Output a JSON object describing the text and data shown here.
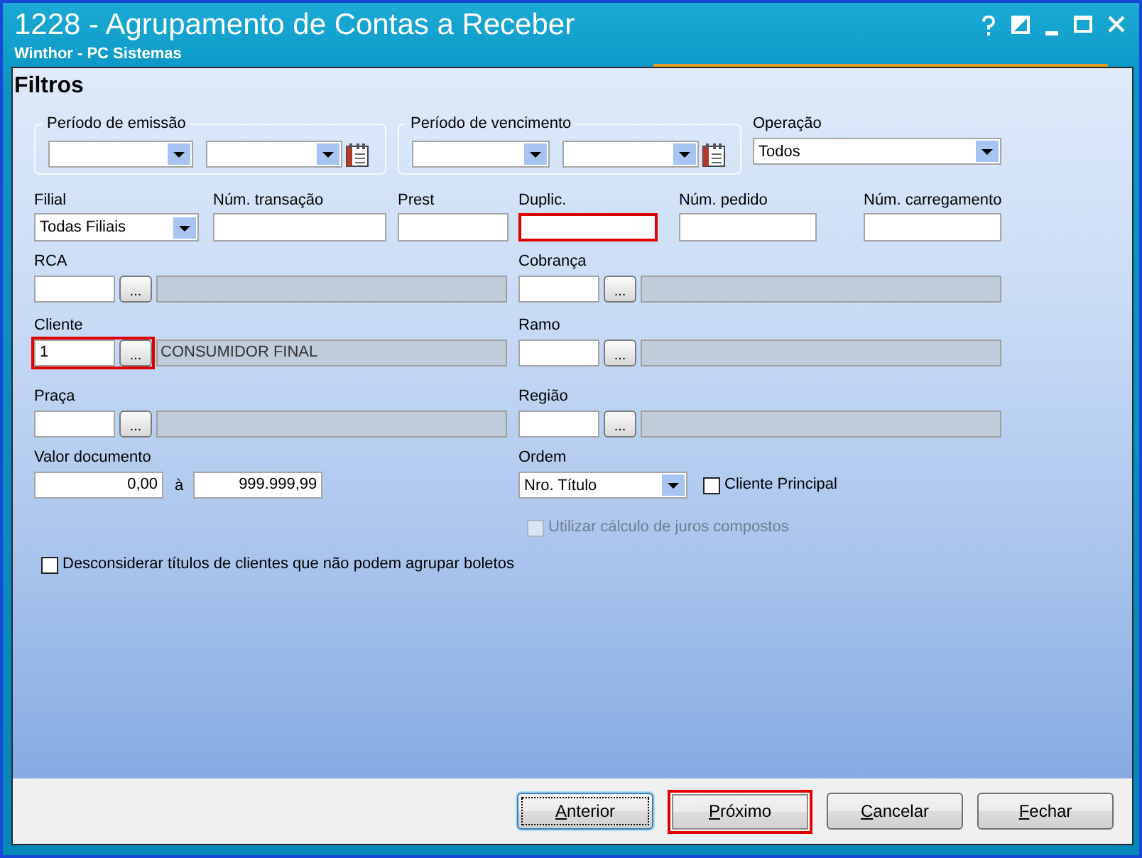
{
  "window": {
    "title": "1228 - Agrupamento de Contas a Receber",
    "subtitle": "Winthor - PC Sistemas"
  },
  "heading": "Filtros",
  "periods": [
    {
      "label": "Período de emissão"
    },
    {
      "label": "Período de vencimento"
    }
  ],
  "operation": {
    "label": "Operação",
    "value": "Todos"
  },
  "fields": [
    {
      "kind": "dropdown",
      "label": "Filial",
      "value": "Todas Filiais",
      "highlighted": false
    },
    {
      "kind": "text",
      "label": "Núm. transação",
      "highlighted": false
    },
    {
      "kind": "text",
      "label": "Prest",
      "highlighted": false
    },
    {
      "kind": "text",
      "label": "Duplic.",
      "highlighted": true
    },
    {
      "kind": "text",
      "label": "Núm. pedido",
      "highlighted": false
    },
    {
      "kind": "text",
      "label": "Núm. carregamento",
      "highlighted": false
    }
  ],
  "lookups": [
    {
      "label": "RCA",
      "button": "...",
      "highlighted": false
    },
    {
      "label": "Cobrança",
      "button": "...",
      "highlighted": false
    },
    {
      "label": "Cliente",
      "value": "1",
      "button": "...",
      "description": "CONSUMIDOR FINAL",
      "highlighted": true
    },
    {
      "label": "Ramo",
      "button": "...",
      "highlighted": false
    },
    {
      "label": "Praça",
      "button": "...",
      "highlighted": false
    },
    {
      "label": "Região",
      "button": "...",
      "highlighted": false
    }
  ],
  "document_value": {
    "label": "Valor documento",
    "from": "0,00",
    "separator": "à",
    "to": "999.999,99"
  },
  "order": {
    "label": "Ordem",
    "value": "Nro. Título"
  },
  "checkboxes": [
    {
      "label": "Cliente Principal",
      "checked": false,
      "disabled": false
    },
    {
      "label": "Utilizar cálculo de juros compostos",
      "checked": false,
      "disabled": true
    },
    {
      "label": "Desconsiderar títulos de clientes que não podem agrupar boletos",
      "checked": false,
      "disabled": false
    }
  ],
  "buttons": [
    {
      "label": "Anterior",
      "focused": true,
      "highlighted": false
    },
    {
      "label": "Próximo",
      "focused": false,
      "highlighted": true
    },
    {
      "label": "Cancelar",
      "focused": false,
      "highlighted": false
    },
    {
      "label": "Fechar",
      "focused": false,
      "highlighted": false
    }
  ]
}
